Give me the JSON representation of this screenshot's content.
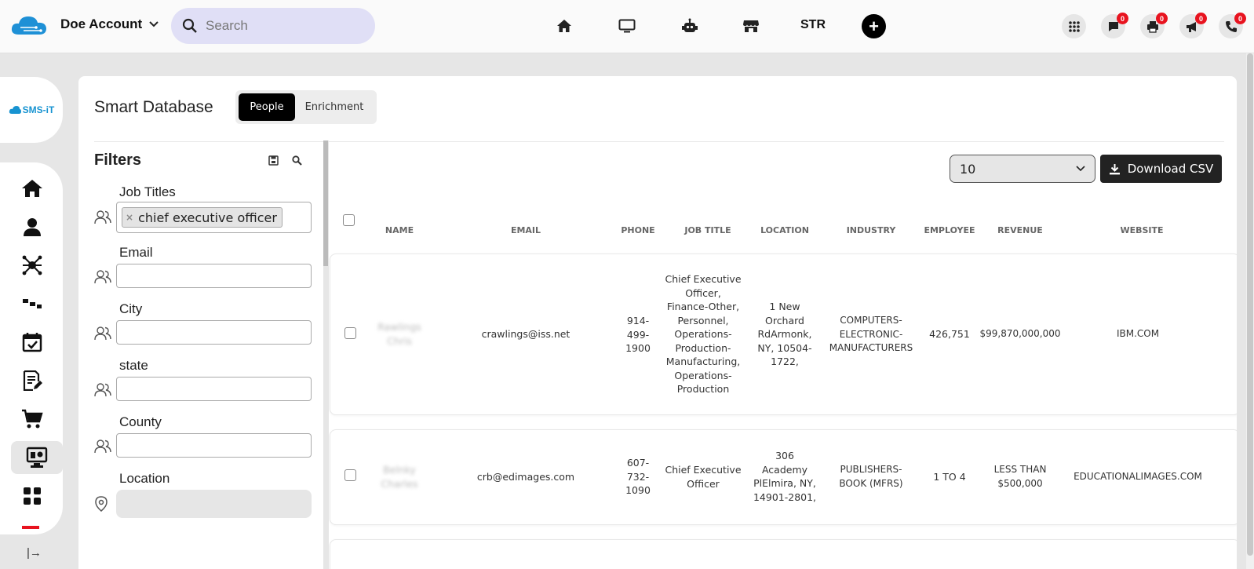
{
  "topbar": {
    "account_name": "Doe Account",
    "search_placeholder": "Search",
    "str_label": "STR",
    "notifications": [
      {
        "name": "chat",
        "count": "0"
      },
      {
        "name": "print",
        "count": "0"
      },
      {
        "name": "megaphone",
        "count": "0"
      },
      {
        "name": "phone",
        "count": "0"
      }
    ]
  },
  "sidebar": {
    "logo_text": "SMS-iT",
    "items": [
      {
        "name": "home-icon"
      },
      {
        "name": "user-icon"
      },
      {
        "name": "network-icon"
      },
      {
        "name": "workflow-icon"
      },
      {
        "name": "calendar-icon"
      },
      {
        "name": "document-edit-icon"
      },
      {
        "name": "cart-icon"
      },
      {
        "name": "smart-database-icon",
        "active": true
      },
      {
        "name": "apps-grid-icon"
      }
    ],
    "collapse_label": "|→"
  },
  "page": {
    "title": "Smart Database",
    "tabs": [
      {
        "label": "People",
        "active": true
      },
      {
        "label": "Enrichment",
        "active": false
      }
    ]
  },
  "filters": {
    "title": "Filters",
    "fields": [
      {
        "label": "Job Titles",
        "tags": [
          "chief executive officer"
        ]
      },
      {
        "label": "Email",
        "value": ""
      },
      {
        "label": "City",
        "value": ""
      },
      {
        "label": "state",
        "value": ""
      },
      {
        "label": "County",
        "value": ""
      },
      {
        "label": "Location",
        "value": ""
      }
    ]
  },
  "table": {
    "page_size": "10",
    "download_label": "Download CSV",
    "columns": [
      "NAME",
      "EMAIL",
      "PHONE",
      "JOB TITLE",
      "LOCATION",
      "INDUSTRY",
      "EMPLOYEE",
      "REVENUE",
      "WEBSITE"
    ],
    "rows": [
      {
        "name": "Rawlings Chris",
        "email": "crawlings@iss.net",
        "phone": "914-499-1900",
        "job_title": "Chief Executive Officer, Finance-Other, Personnel, Operations-Production-Manufacturing, Operations-Production",
        "location": "1 New Orchard RdArmonk, NY, 10504-1722,",
        "industry": "COMPUTERS-ELECTRONIC-MANUFACTURERS",
        "employee": "426,751",
        "revenue": "$99,870,000,000",
        "website": "IBM.COM"
      },
      {
        "name": "Belnky Charles",
        "email": "crb@edimages.com",
        "phone": "607-732-1090",
        "job_title": "Chief Executive Officer",
        "location": "306 Academy PlElmira, NY, 14901-2801,",
        "industry": "PUBLISHERS-BOOK (MFRS)",
        "employee": "1 TO 4",
        "revenue": "LESS THAN $500,000",
        "website": "EDUCATIONALIMAGES.COM"
      }
    ]
  },
  "colors": {
    "accent": "#000000",
    "search_bg": "#e0dff6",
    "badge": "#e8131f",
    "brand_blue": "#1793d1"
  }
}
